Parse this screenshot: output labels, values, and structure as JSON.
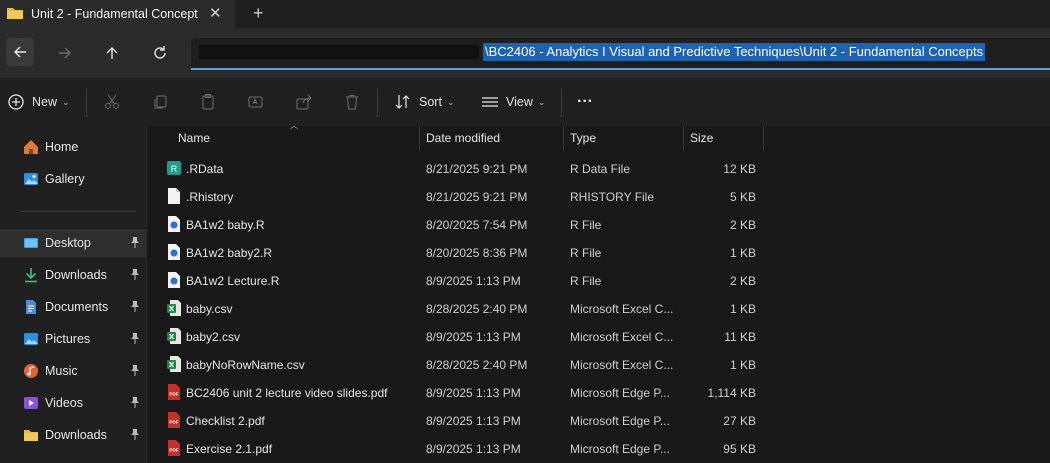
{
  "tab": {
    "title": "Unit 2 - Fundamental Concept",
    "close": "✕",
    "new_tab": "+"
  },
  "address": {
    "path": "\\BC2406 - Analytics I Visual and Predictive Techniques\\Unit 2 - Fundamental Concepts"
  },
  "toolbar": {
    "new_label": "New",
    "sort_label": "Sort",
    "view_label": "View",
    "more_label": "···"
  },
  "sidebar": {
    "items": [
      {
        "label": "Home",
        "icon": "home-icon"
      },
      {
        "label": "Gallery",
        "icon": "gallery-icon"
      },
      {
        "label": "Desktop",
        "icon": "desktop-icon",
        "pinned": true,
        "selected": true
      },
      {
        "label": "Downloads",
        "icon": "download-icon",
        "pinned": true
      },
      {
        "label": "Documents",
        "icon": "documents-icon",
        "pinned": true
      },
      {
        "label": "Pictures",
        "icon": "pictures-icon",
        "pinned": true
      },
      {
        "label": "Music",
        "icon": "music-icon",
        "pinned": true
      },
      {
        "label": "Videos",
        "icon": "videos-icon",
        "pinned": true
      },
      {
        "label": "Downloads",
        "icon": "folder-icon",
        "pinned": true
      }
    ]
  },
  "columns": {
    "name": "Name",
    "date": "Date modified",
    "type": "Type",
    "size": "Size"
  },
  "files": [
    {
      "name": ".RData",
      "date": "8/21/2025 9:21 PM",
      "type": "R Data File",
      "size": "12 KB",
      "icon": "rdata-icon"
    },
    {
      "name": ".Rhistory",
      "date": "8/21/2025 9:21 PM",
      "type": "RHISTORY File",
      "size": "5 KB",
      "icon": "blank-file-icon"
    },
    {
      "name": "BA1w2 baby.R",
      "date": "8/20/2025 7:54 PM",
      "type": "R File",
      "size": "2 KB",
      "icon": "r-script-icon"
    },
    {
      "name": "BA1w2 baby2.R",
      "date": "8/20/2025 8:36 PM",
      "type": "R File",
      "size": "1 KB",
      "icon": "r-script-icon"
    },
    {
      "name": "BA1w2 Lecture.R",
      "date": "8/9/2025 1:13 PM",
      "type": "R File",
      "size": "2 KB",
      "icon": "r-script-icon"
    },
    {
      "name": "baby.csv",
      "date": "8/28/2025 2:40 PM",
      "type": "Microsoft Excel C...",
      "size": "1 KB",
      "icon": "excel-icon"
    },
    {
      "name": "baby2.csv",
      "date": "8/9/2025 1:13 PM",
      "type": "Microsoft Excel C...",
      "size": "11 KB",
      "icon": "excel-icon"
    },
    {
      "name": "babyNoRowName.csv",
      "date": "8/28/2025 2:40 PM",
      "type": "Microsoft Excel C...",
      "size": "1 KB",
      "icon": "excel-icon"
    },
    {
      "name": "BC2406 unit 2 lecture video slides.pdf",
      "date": "8/9/2025 1:13 PM",
      "type": "Microsoft Edge P...",
      "size": "1,114 KB",
      "icon": "pdf-icon"
    },
    {
      "name": "Checklist 2.pdf",
      "date": "8/9/2025 1:13 PM",
      "type": "Microsoft Edge P...",
      "size": "27 KB",
      "icon": "pdf-icon"
    },
    {
      "name": "Exercise 2.1.pdf",
      "date": "8/9/2025 1:13 PM",
      "type": "Microsoft Edge P...",
      "size": "95 KB",
      "icon": "pdf-icon"
    }
  ],
  "colors": {
    "accent": "#5aa0e8",
    "selection": "#1e62b0",
    "excel": "#1d8a45",
    "pdf": "#c4312b"
  }
}
